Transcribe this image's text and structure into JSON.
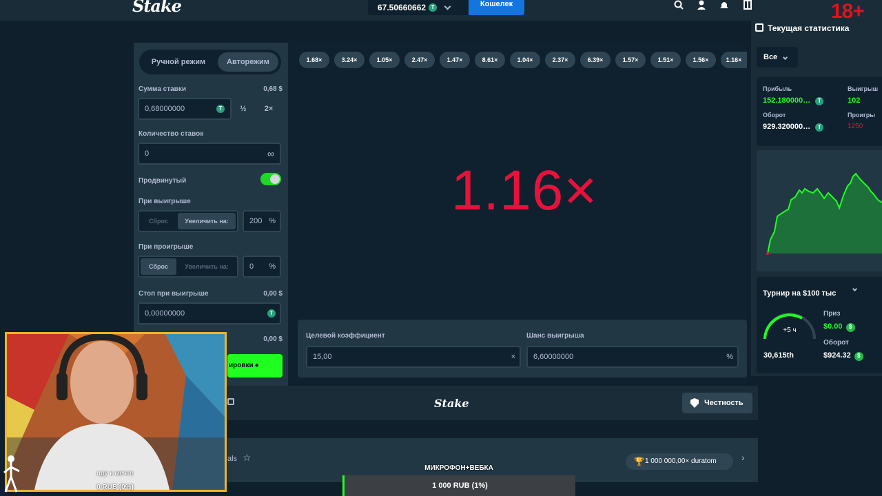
{
  "header": {
    "logo": "Stake",
    "balance": "67.50660662",
    "wallet_label": "Кошелек",
    "age_badge": "18+"
  },
  "controls": {
    "mode_manual": "Ручной режим",
    "mode_auto": "Авторежим",
    "bet_amount_label": "Сумма ставки",
    "bet_amount_usd": "0,68 $",
    "bet_amount_value": "0,68000000",
    "half_label": "½",
    "double_label": "2×",
    "num_bets_label": "Количество ставок",
    "num_bets_value": "0",
    "infinity_symbol": "∞",
    "advanced_label": "Продвинутый",
    "on_win_label": "При выигрыше",
    "on_win_reset": "Сброс",
    "on_win_increase": "Увеличить на:",
    "on_win_value": "200",
    "percent_symbol": "%",
    "on_loss_label": "При проигрыше",
    "on_loss_reset": "Сброс",
    "on_loss_increase": "Увеличить на:",
    "on_loss_value": "0",
    "stop_win_label": "Стоп при выигрыше",
    "stop_win_usd": "0,00 $",
    "stop_win_value": "0,00000000",
    "stop_loss_usd": "0,00 $",
    "start_autobet_label": "ировки"
  },
  "history": [
    "1.68×",
    "3.24×",
    "1.05×",
    "2.47×",
    "1.47×",
    "8.61×",
    "1.04×",
    "2.37×",
    "6.39×",
    "1.57×",
    "1.51×",
    "1.56×",
    "1.16×"
  ],
  "game": {
    "multiplier": "1.16×",
    "target_label": "Целевой коэффициент",
    "target_value": "15,00",
    "win_chance_label": "Шанс выигрыша",
    "win_chance_value": "6,60000000",
    "clear_symbol": "×",
    "percent_symbol": "%"
  },
  "footer": {
    "logo": "Stake",
    "fairness_label": "Честность",
    "row_label": "als",
    "trophy_text": "1 000 000,00× duratom"
  },
  "stats": {
    "title": "Текущая статистика",
    "filter": "Все",
    "profit_label": "Прибыль",
    "profit_value": "152.180000…",
    "wins_label": "Выигрыш",
    "wins_value": "102",
    "wagered_label": "Оборот",
    "wagered_value": "929.320000…",
    "losses_label": "Проигры",
    "losses_value": "1250",
    "colors": {
      "profit": "#1fff20",
      "losses": "#e9113c"
    }
  },
  "race": {
    "title": "Турнир на $100 тыс",
    "timer": "+5 ч",
    "rank": "30,615th",
    "prize_label": "Приз",
    "prize_value": "$0.00",
    "wagered_label": "Оборот",
    "wagered_value": "$924.32"
  },
  "overlay": {
    "caption": "иду к мечте",
    "rub": "0 RUB (0%)",
    "goal_title": "МИКРОФОН+ВЕБКА",
    "goal_progress": "1 000 RUB (1%)"
  }
}
